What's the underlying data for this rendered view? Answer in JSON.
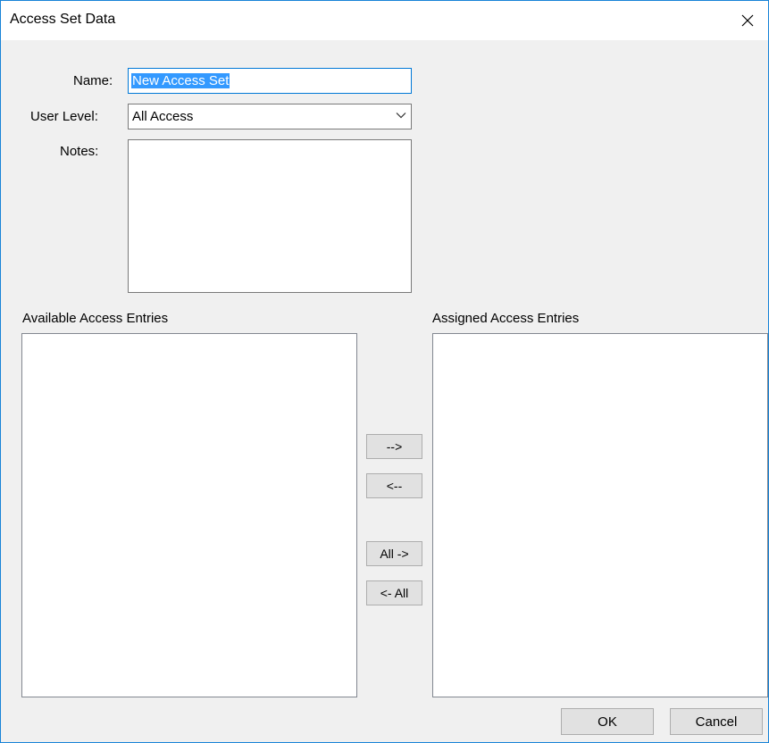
{
  "window": {
    "title": "Access Set Data",
    "close_icon": "close-icon"
  },
  "form": {
    "name_label": "Name:",
    "name_value": "New Access Set",
    "user_level_label": "User Level:",
    "user_level_value": "All Access",
    "notes_label": "Notes:",
    "notes_value": ""
  },
  "lists": {
    "available_label": "Available Access Entries",
    "assigned_label": "Assigned Access Entries",
    "available_items": [],
    "assigned_items": []
  },
  "transfer": {
    "add_label": "-->",
    "remove_label": "<--",
    "add_all_label": "All ->",
    "remove_all_label": "<- All"
  },
  "dialog": {
    "ok_label": "OK",
    "cancel_label": "Cancel"
  }
}
